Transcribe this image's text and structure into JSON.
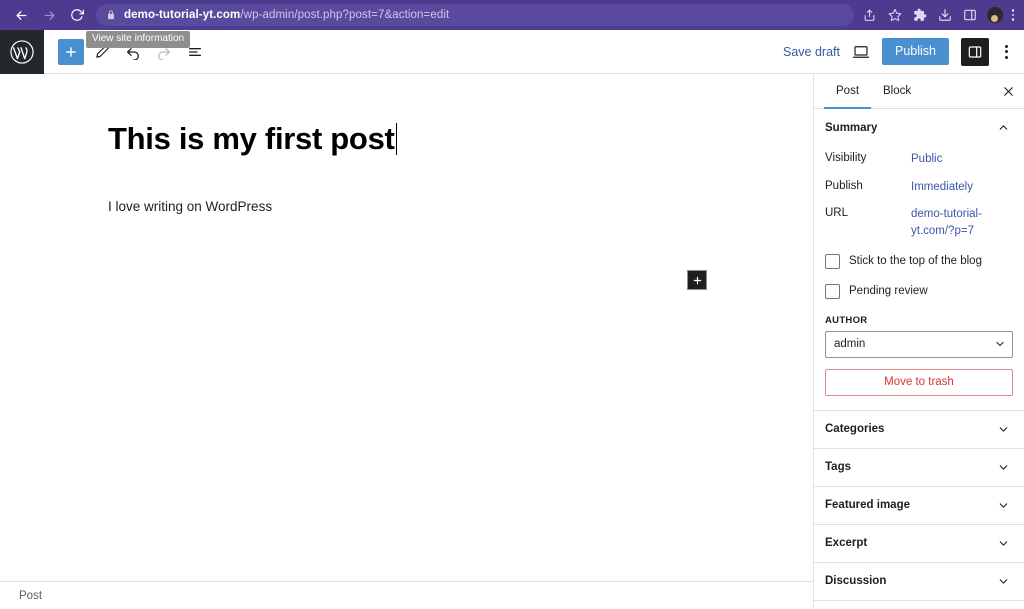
{
  "browser": {
    "back_icon": "back-arrow-icon",
    "forward_icon": "forward-arrow-icon",
    "reload_icon": "reload-icon",
    "lock_icon": "lock-icon",
    "url_domain": "demo-tutorial-yt.com",
    "url_path": "/wp-admin/post.php?post=7&action=edit",
    "icons": [
      "share-icon",
      "bookmark-star-icon",
      "extensions-puzzle-icon",
      "downloads-icon",
      "side-panel-icon",
      "profile-avatar-icon",
      "browser-menu-icon"
    ]
  },
  "editor_toolbar": {
    "logo": "wordpress-logo-icon",
    "add_block_icon": "plus-icon",
    "tools_icon": "pencil-icon",
    "undo_icon": "undo-arrow-icon",
    "redo_icon": "redo-arrow-icon",
    "list_view_icon": "document-outline-icon",
    "tooltip": "View site information",
    "save_draft_label": "Save draft",
    "preview_icon": "desktop-preview-icon",
    "publish_label": "Publish",
    "settings_icon": "settings-sidebar-icon",
    "more_menu_icon": "more-options-icon",
    "accent_blue": "#4a90d0"
  },
  "editor": {
    "title": "This is my first post",
    "paragraph": "I love writing on WordPress",
    "block_inserter_icon": "plus-icon",
    "breadcrumb": "Post"
  },
  "sidebar": {
    "tabs": [
      {
        "label": "Post",
        "active": true
      },
      {
        "label": "Block",
        "active": false
      }
    ],
    "close_icon": "close-icon",
    "summary": {
      "title": "Summary",
      "chevron": "chevron-up-icon",
      "rows": [
        {
          "label": "Visibility",
          "value": "Public"
        },
        {
          "label": "Publish",
          "value": "Immediately"
        },
        {
          "label": "URL",
          "value": "demo-tutorial-yt.com/?p=7"
        }
      ],
      "checkboxes": [
        {
          "label": "Stick to the top of the blog",
          "checked": false
        },
        {
          "label": "Pending review",
          "checked": false
        }
      ],
      "author_label": "AUTHOR",
      "author_value": "admin",
      "trash_label": "Move to trash",
      "trash_color": "#d63638"
    },
    "panels": [
      {
        "title": "Categories",
        "chevron": "chevron-down-icon"
      },
      {
        "title": "Tags",
        "chevron": "chevron-down-icon"
      },
      {
        "title": "Featured image",
        "chevron": "chevron-down-icon"
      },
      {
        "title": "Excerpt",
        "chevron": "chevron-down-icon"
      },
      {
        "title": "Discussion",
        "chevron": "chevron-down-icon"
      }
    ]
  }
}
